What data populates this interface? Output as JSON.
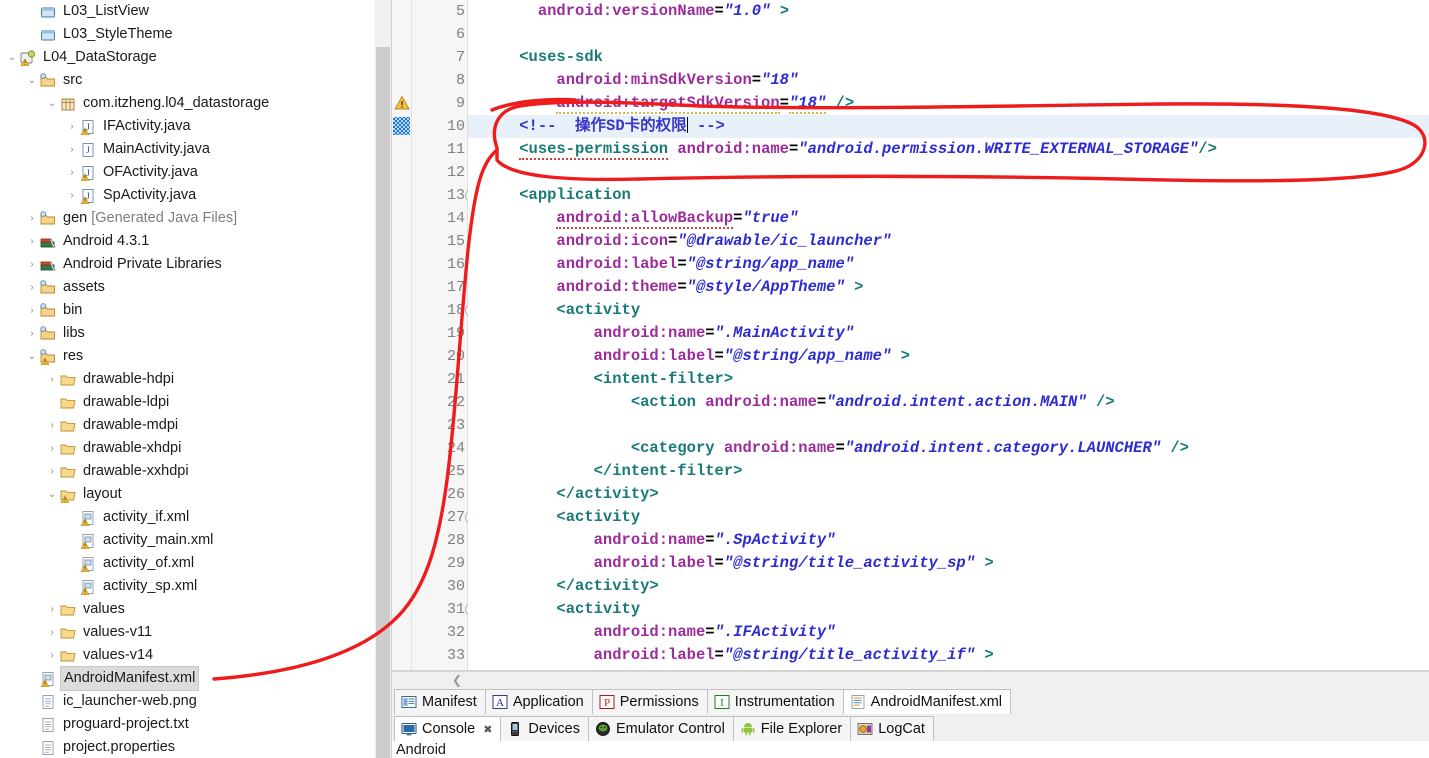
{
  "explorer": {
    "name": "package-explorer",
    "items": [
      {
        "label": "L03_ListView",
        "indent": 1,
        "twist": "none",
        "icon": "project-closed-icon"
      },
      {
        "label": "L03_StyleTheme",
        "indent": 1,
        "twist": "none",
        "icon": "project-closed-icon"
      },
      {
        "label": "L04_DataStorage",
        "indent": 0,
        "twist": "expanded",
        "icon": "android-project-icon"
      },
      {
        "label": "src",
        "indent": 1,
        "twist": "expanded",
        "icon": "source-folder-icon"
      },
      {
        "label": "com.itzheng.l04_datastorage",
        "indent": 2,
        "twist": "expanded",
        "icon": "package-icon"
      },
      {
        "label": "IFActivity.java",
        "indent": 3,
        "twist": "collapsed",
        "icon": "java-warning-icon"
      },
      {
        "label": "MainActivity.java",
        "indent": 3,
        "twist": "collapsed",
        "icon": "java-icon"
      },
      {
        "label": "OFActivity.java",
        "indent": 3,
        "twist": "collapsed",
        "icon": "java-warning-icon"
      },
      {
        "label": "SpActivity.java",
        "indent": 3,
        "twist": "collapsed",
        "icon": "java-warning-icon"
      },
      {
        "label": "gen [Generated Java Files]",
        "indent": 1,
        "twist": "collapsed",
        "icon": "source-folder-icon",
        "dim_from": 3
      },
      {
        "label": "Android 4.3.1",
        "indent": 1,
        "twist": "collapsed",
        "icon": "library-icon"
      },
      {
        "label": "Android Private Libraries",
        "indent": 1,
        "twist": "collapsed",
        "icon": "library-icon"
      },
      {
        "label": "assets",
        "indent": 1,
        "twist": "collapsed",
        "icon": "folder-res-icon"
      },
      {
        "label": "bin",
        "indent": 1,
        "twist": "collapsed",
        "icon": "folder-res-icon"
      },
      {
        "label": "libs",
        "indent": 1,
        "twist": "collapsed",
        "icon": "folder-res-icon"
      },
      {
        "label": "res",
        "indent": 1,
        "twist": "expanded",
        "icon": "folder-res-warning-icon"
      },
      {
        "label": "drawable-hdpi",
        "indent": 2,
        "twist": "collapsed",
        "icon": "folder-icon"
      },
      {
        "label": "drawable-ldpi",
        "indent": 2,
        "twist": "none",
        "icon": "folder-icon"
      },
      {
        "label": "drawable-mdpi",
        "indent": 2,
        "twist": "collapsed",
        "icon": "folder-icon"
      },
      {
        "label": "drawable-xhdpi",
        "indent": 2,
        "twist": "collapsed",
        "icon": "folder-icon"
      },
      {
        "label": "drawable-xxhdpi",
        "indent": 2,
        "twist": "collapsed",
        "icon": "folder-icon"
      },
      {
        "label": "layout",
        "indent": 2,
        "twist": "expanded",
        "icon": "folder-warning-icon"
      },
      {
        "label": "activity_if.xml",
        "indent": 3,
        "twist": "none",
        "icon": "xml-warning-icon"
      },
      {
        "label": "activity_main.xml",
        "indent": 3,
        "twist": "none",
        "icon": "xml-warning-icon"
      },
      {
        "label": "activity_of.xml",
        "indent": 3,
        "twist": "none",
        "icon": "xml-warning-icon"
      },
      {
        "label": "activity_sp.xml",
        "indent": 3,
        "twist": "none",
        "icon": "xml-warning-icon"
      },
      {
        "label": "values",
        "indent": 2,
        "twist": "collapsed",
        "icon": "folder-icon"
      },
      {
        "label": "values-v11",
        "indent": 2,
        "twist": "collapsed",
        "icon": "folder-icon"
      },
      {
        "label": "values-v14",
        "indent": 2,
        "twist": "collapsed",
        "icon": "folder-icon"
      },
      {
        "label": "AndroidManifest.xml",
        "indent": 1,
        "twist": "none",
        "icon": "xml-warning-icon",
        "selected": true
      },
      {
        "label": "ic_launcher-web.png",
        "indent": 1,
        "twist": "none",
        "icon": "file-icon"
      },
      {
        "label": "proguard-project.txt",
        "indent": 1,
        "twist": "none",
        "icon": "file-icon"
      },
      {
        "label": "project.properties",
        "indent": 1,
        "twist": "none",
        "icon": "file-icon"
      }
    ]
  },
  "editor": {
    "name": "androidmanifest-xml-editor",
    "first_line": 5,
    "current_line": 10,
    "warning_line": 9,
    "fold_lines": [
      13,
      18,
      27,
      31
    ],
    "lines": [
      {
        "n": 5,
        "segments": [
          {
            "t": "      ",
            "c": "pnc"
          },
          {
            "t": "android:versionName",
            "c": "attr"
          },
          {
            "t": "=",
            "c": "pnc"
          },
          {
            "t": "\"1.0\"",
            "c": "val"
          },
          {
            "t": " ",
            "c": "pnc"
          },
          {
            "t": ">",
            "c": "tag"
          }
        ]
      },
      {
        "n": 6,
        "segments": []
      },
      {
        "n": 7,
        "segments": [
          {
            "t": "    ",
            "c": "pnc"
          },
          {
            "t": "<uses-sdk",
            "c": "tag"
          }
        ]
      },
      {
        "n": 8,
        "segments": [
          {
            "t": "        ",
            "c": "pnc"
          },
          {
            "t": "android:minSdkVersion",
            "c": "attr"
          },
          {
            "t": "=",
            "c": "pnc"
          },
          {
            "t": "\"18\"",
            "c": "val"
          }
        ]
      },
      {
        "n": 9,
        "segments": [
          {
            "t": "        ",
            "c": "pnc"
          },
          {
            "t": "android:targetSdkVersion",
            "c": "attr"
          },
          {
            "t": "=",
            "c": "pnc"
          },
          {
            "t": "\"18\"",
            "c": "val"
          },
          {
            "t": " ",
            "c": "pnc"
          },
          {
            "t": "/>",
            "c": "tag"
          }
        ]
      },
      {
        "n": 10,
        "segments": [
          {
            "t": "    ",
            "c": "pnc"
          },
          {
            "t": "<!--  操作SD卡的权限",
            "c": "cmt"
          },
          {
            "t": "CARET",
            "c": "caret"
          },
          {
            "t": " -->",
            "c": "cmt"
          }
        ]
      },
      {
        "n": 11,
        "segments": [
          {
            "t": "    ",
            "c": "pnc"
          },
          {
            "t": "<uses-permission",
            "c": "tag"
          },
          {
            "t": " ",
            "c": "pnc"
          },
          {
            "t": "android:name",
            "c": "attr"
          },
          {
            "t": "=",
            "c": "pnc"
          },
          {
            "t": "\"android.permission.WRITE_EXTERNAL_STORAGE\"",
            "c": "val"
          },
          {
            "t": "/>",
            "c": "tag"
          }
        ]
      },
      {
        "n": 12,
        "segments": []
      },
      {
        "n": 13,
        "segments": [
          {
            "t": "    ",
            "c": "pnc"
          },
          {
            "t": "<application",
            "c": "tag"
          }
        ]
      },
      {
        "n": 14,
        "segments": [
          {
            "t": "        ",
            "c": "pnc"
          },
          {
            "t": "android:allowBackup",
            "c": "attr"
          },
          {
            "t": "=",
            "c": "pnc"
          },
          {
            "t": "\"true\"",
            "c": "val"
          }
        ]
      },
      {
        "n": 15,
        "segments": [
          {
            "t": "        ",
            "c": "pnc"
          },
          {
            "t": "android:icon",
            "c": "attr"
          },
          {
            "t": "=",
            "c": "pnc"
          },
          {
            "t": "\"@drawable/ic_launcher\"",
            "c": "val"
          }
        ]
      },
      {
        "n": 16,
        "segments": [
          {
            "t": "        ",
            "c": "pnc"
          },
          {
            "t": "android:label",
            "c": "attr"
          },
          {
            "t": "=",
            "c": "pnc"
          },
          {
            "t": "\"@string/app_name\"",
            "c": "val"
          }
        ]
      },
      {
        "n": 17,
        "segments": [
          {
            "t": "        ",
            "c": "pnc"
          },
          {
            "t": "android:theme",
            "c": "attr"
          },
          {
            "t": "=",
            "c": "pnc"
          },
          {
            "t": "\"@style/AppTheme\"",
            "c": "val"
          },
          {
            "t": " ",
            "c": "pnc"
          },
          {
            "t": ">",
            "c": "tag"
          }
        ]
      },
      {
        "n": 18,
        "segments": [
          {
            "t": "        ",
            "c": "pnc"
          },
          {
            "t": "<activity",
            "c": "tag"
          }
        ]
      },
      {
        "n": 19,
        "segments": [
          {
            "t": "            ",
            "c": "pnc"
          },
          {
            "t": "android:name",
            "c": "attr"
          },
          {
            "t": "=",
            "c": "pnc"
          },
          {
            "t": "\".MainActivity\"",
            "c": "val"
          }
        ]
      },
      {
        "n": 20,
        "segments": [
          {
            "t": "            ",
            "c": "pnc"
          },
          {
            "t": "android:label",
            "c": "attr"
          },
          {
            "t": "=",
            "c": "pnc"
          },
          {
            "t": "\"@string/app_name\"",
            "c": "val"
          },
          {
            "t": " ",
            "c": "pnc"
          },
          {
            "t": ">",
            "c": "tag"
          }
        ]
      },
      {
        "n": 21,
        "segments": [
          {
            "t": "            ",
            "c": "pnc"
          },
          {
            "t": "<intent-filter>",
            "c": "tag"
          }
        ]
      },
      {
        "n": 22,
        "segments": [
          {
            "t": "                ",
            "c": "pnc"
          },
          {
            "t": "<action",
            "c": "tag"
          },
          {
            "t": " ",
            "c": "pnc"
          },
          {
            "t": "android:name",
            "c": "attr"
          },
          {
            "t": "=",
            "c": "pnc"
          },
          {
            "t": "\"android.intent.action.MAIN\"",
            "c": "val"
          },
          {
            "t": " ",
            "c": "pnc"
          },
          {
            "t": "/>",
            "c": "tag"
          }
        ]
      },
      {
        "n": 23,
        "segments": []
      },
      {
        "n": 24,
        "segments": [
          {
            "t": "                ",
            "c": "pnc"
          },
          {
            "t": "<category",
            "c": "tag"
          },
          {
            "t": " ",
            "c": "pnc"
          },
          {
            "t": "android:name",
            "c": "attr"
          },
          {
            "t": "=",
            "c": "pnc"
          },
          {
            "t": "\"android.intent.category.LAUNCHER\"",
            "c": "val"
          },
          {
            "t": " ",
            "c": "pnc"
          },
          {
            "t": "/>",
            "c": "tag"
          }
        ]
      },
      {
        "n": 25,
        "segments": [
          {
            "t": "            ",
            "c": "pnc"
          },
          {
            "t": "</intent-filter>",
            "c": "tag"
          }
        ]
      },
      {
        "n": 26,
        "segments": [
          {
            "t": "        ",
            "c": "pnc"
          },
          {
            "t": "</activity>",
            "c": "tag"
          }
        ]
      },
      {
        "n": 27,
        "segments": [
          {
            "t": "        ",
            "c": "pnc"
          },
          {
            "t": "<activity",
            "c": "tag"
          }
        ]
      },
      {
        "n": 28,
        "segments": [
          {
            "t": "            ",
            "c": "pnc"
          },
          {
            "t": "android:name",
            "c": "attr"
          },
          {
            "t": "=",
            "c": "pnc"
          },
          {
            "t": "\".SpActivity\"",
            "c": "val"
          }
        ]
      },
      {
        "n": 29,
        "segments": [
          {
            "t": "            ",
            "c": "pnc"
          },
          {
            "t": "android:label",
            "c": "attr"
          },
          {
            "t": "=",
            "c": "pnc"
          },
          {
            "t": "\"@string/title_activity_sp\"",
            "c": "val"
          },
          {
            "t": " ",
            "c": "pnc"
          },
          {
            "t": ">",
            "c": "tag"
          }
        ]
      },
      {
        "n": 30,
        "segments": [
          {
            "t": "        ",
            "c": "pnc"
          },
          {
            "t": "</activity>",
            "c": "tag"
          }
        ]
      },
      {
        "n": 31,
        "segments": [
          {
            "t": "        ",
            "c": "pnc"
          },
          {
            "t": "<activity",
            "c": "tag"
          }
        ]
      },
      {
        "n": 32,
        "segments": [
          {
            "t": "            ",
            "c": "pnc"
          },
          {
            "t": "android:name",
            "c": "attr"
          },
          {
            "t": "=",
            "c": "pnc"
          },
          {
            "t": "\".IFActivity\"",
            "c": "val"
          }
        ]
      },
      {
        "n": 33,
        "segments": [
          {
            "t": "            ",
            "c": "pnc"
          },
          {
            "t": "android:label",
            "c": "attr"
          },
          {
            "t": "=",
            "c": "pnc"
          },
          {
            "t": "\"@string/title_activity_if\"",
            "c": "val"
          },
          {
            "t": " ",
            "c": "pnc"
          },
          {
            "t": ">",
            "c": "tag"
          }
        ]
      }
    ]
  },
  "manifest_tabs": {
    "name": "manifest-editor-tabs",
    "items": [
      {
        "label": "Manifest",
        "icon": "manifest-icon",
        "active": false
      },
      {
        "label": "Application",
        "icon": "application-a-icon",
        "active": false
      },
      {
        "label": "Permissions",
        "icon": "permissions-p-icon",
        "active": false
      },
      {
        "label": "Instrumentation",
        "icon": "instrumentation-i-icon",
        "active": false
      },
      {
        "label": "AndroidManifest.xml",
        "icon": "xml-source-icon",
        "active": true
      }
    ]
  },
  "console_tabs": {
    "name": "console-view-tabs",
    "items": [
      {
        "label": "Console",
        "icon": "console-icon",
        "active": true,
        "closeable": true
      },
      {
        "label": "Devices",
        "icon": "devices-icon",
        "active": false,
        "closeable": false
      },
      {
        "label": "Emulator Control",
        "icon": "emulator-control-icon",
        "active": false,
        "closeable": false
      },
      {
        "label": "File Explorer",
        "icon": "file-explorer-icon",
        "active": false,
        "closeable": false
      },
      {
        "label": "LogCat",
        "icon": "logcat-icon",
        "active": false,
        "closeable": false
      }
    ]
  },
  "console": {
    "name": "console-output",
    "text": "Android"
  },
  "annotation": {
    "name": "red-ink-annotation",
    "color": "#ee1c1c",
    "description": "hand-drawn red ellipse around lines 10-11 with a leader line to AndroidManifest.xml in the explorer"
  }
}
